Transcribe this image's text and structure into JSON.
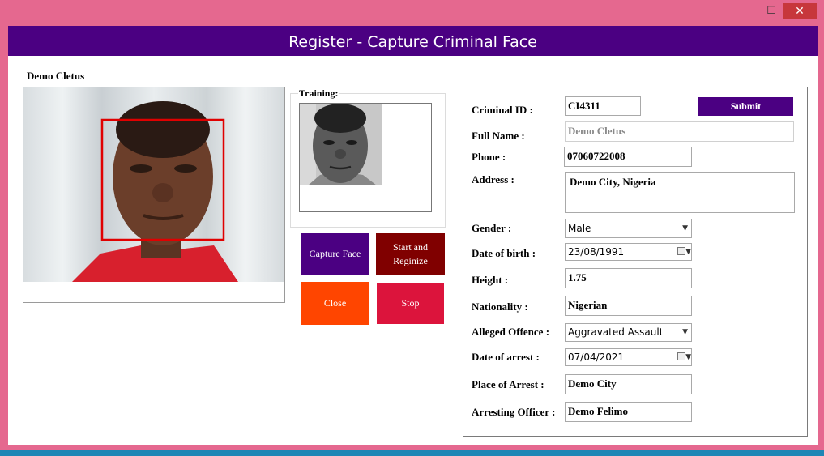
{
  "window": {
    "minimize": "–",
    "maximize": "☐",
    "close": "✕"
  },
  "header": {
    "title": "Register - Capture Criminal Face"
  },
  "camera": {
    "name_label": "Demo Cletus"
  },
  "training": {
    "label": "Training:"
  },
  "buttons": {
    "capture": "Capture Face",
    "start": "Start and Reginize",
    "close": "Close",
    "stop": "Stop",
    "submit": "Submit"
  },
  "form": {
    "criminal_id": {
      "label": "Criminal ID :",
      "value": "CI4311"
    },
    "full_name": {
      "label": "Full Name :",
      "value": "Demo Cletus"
    },
    "phone": {
      "label": "Phone :",
      "value": "07060722008"
    },
    "address": {
      "label": "Address :",
      "value": "Demo City, Nigeria"
    },
    "gender": {
      "label": "Gender :",
      "value": "Male"
    },
    "dob": {
      "label": "Date of birth :",
      "value": "23/08/1991"
    },
    "height": {
      "label": "Height :",
      "value": "1.75"
    },
    "nationality": {
      "label": "Nationality :",
      "value": "Nigerian"
    },
    "offence": {
      "label": "Alleged Offence :",
      "value": "Aggravated Assault"
    },
    "arrest_date": {
      "label": "Date of arrest :",
      "value": "07/04/2021"
    },
    "arrest_place": {
      "label": "Place of Arrest :",
      "value": "Demo City"
    },
    "officer": {
      "label": "Arresting Officer :",
      "value": "Demo Felimo"
    }
  },
  "icons": {
    "calendar": "calendar-icon",
    "dropdown": "chevron-down-icon"
  },
  "colors": {
    "window_frame": "#e5688f",
    "header": "#4b0082",
    "capture": "#4b0082",
    "start": "#800000",
    "close": "#ff4500",
    "stop": "#dc143c",
    "face_box": "#e00000"
  }
}
